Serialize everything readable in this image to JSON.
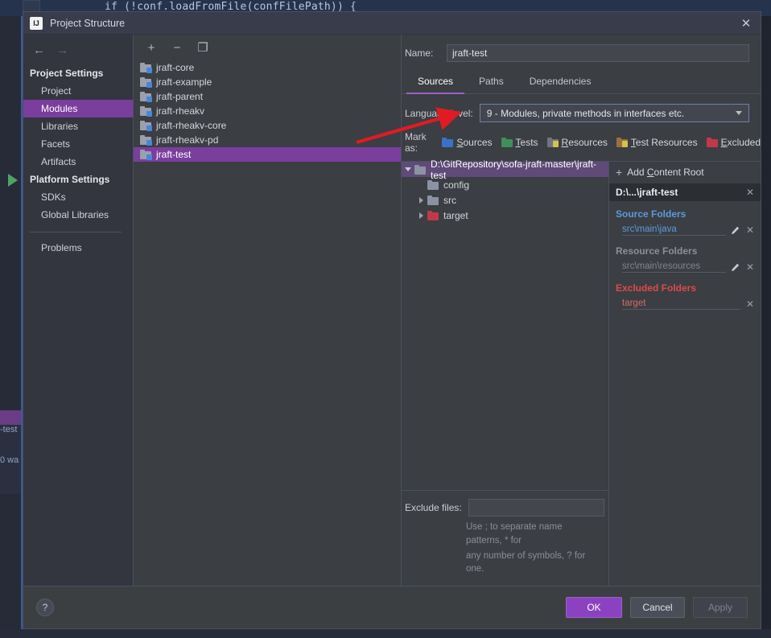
{
  "background": {
    "code_line": "if (!conf.loadFromFile(confFilePath)) {",
    "fragment_test": "-test",
    "fragment_warn": "0 wa"
  },
  "dialog": {
    "title": "Project Structure",
    "app_icon_label": "IJ",
    "close_icon": "✕"
  },
  "sidebar": {
    "nav_back_icon": "←",
    "nav_forward_icon": "→",
    "groups": [
      {
        "label": "Project Settings",
        "items": [
          {
            "label": "Project",
            "selected": false
          },
          {
            "label": "Modules",
            "selected": true
          },
          {
            "label": "Libraries",
            "selected": false
          },
          {
            "label": "Facets",
            "selected": false
          },
          {
            "label": "Artifacts",
            "selected": false
          }
        ]
      },
      {
        "label": "Platform Settings",
        "items": [
          {
            "label": "SDKs",
            "selected": false
          },
          {
            "label": "Global Libraries",
            "selected": false
          }
        ]
      }
    ],
    "problems_label": "Problems"
  },
  "modules_pane": {
    "toolbar": {
      "add_icon": "+",
      "remove_icon": "−",
      "copy_icon": "❐"
    },
    "modules": [
      {
        "name": "jraft-core",
        "selected": false
      },
      {
        "name": "jraft-example",
        "selected": false
      },
      {
        "name": "jraft-parent",
        "selected": false
      },
      {
        "name": "jraft-rheakv",
        "selected": false
      },
      {
        "name": "jraft-rheakv-core",
        "selected": false
      },
      {
        "name": "jraft-rheakv-pd",
        "selected": false
      },
      {
        "name": "jraft-test",
        "selected": true
      }
    ]
  },
  "details": {
    "name_label": "Name:",
    "name_value": "jraft-test",
    "tabs": [
      {
        "label": "Sources",
        "active": true
      },
      {
        "label": "Paths",
        "active": false
      },
      {
        "label": "Dependencies",
        "active": false
      }
    ],
    "language_level_label": "Language level:",
    "language_level_value": "9 - Modules, private methods in interfaces etc.",
    "mark_as_label": "Mark as:",
    "mark_as_options": [
      {
        "label": "Sources",
        "mnemonic": "S",
        "color": "#3c72c4",
        "overlay": ""
      },
      {
        "label": "Tests",
        "mnemonic": "T",
        "color": "#3f8f5d",
        "overlay": ""
      },
      {
        "label": "Resources",
        "mnemonic": "R",
        "color": "#6f7580",
        "overlay": "#d6c14a"
      },
      {
        "label": "Test Resources",
        "mnemonic": "T",
        "color": "#9a6f3f",
        "overlay": "#d6c14a"
      },
      {
        "label": "Excluded",
        "mnemonic": "E",
        "color": "#c0394b",
        "overlay": ""
      }
    ]
  },
  "tree": {
    "root": {
      "label": "D:\\GitRepository\\sofa-jraft-master\\jraft-test",
      "expanded": true,
      "color": "#8b93a3"
    },
    "children": [
      {
        "label": "config",
        "has_arrow": false,
        "expanded": false,
        "color": "#8b93a3"
      },
      {
        "label": "src",
        "has_arrow": true,
        "expanded": false,
        "color": "#8b93a3"
      },
      {
        "label": "target",
        "has_arrow": true,
        "expanded": false,
        "color": "#c0394b"
      }
    ]
  },
  "exclude": {
    "label": "Exclude files:",
    "value": "",
    "hint_line1": "Use ; to separate name patterns, * for",
    "hint_line2": "any number of symbols, ? for one."
  },
  "content_roots": {
    "add_label": "Add Content Root",
    "add_mnemonic": "C",
    "add_icon": "+",
    "root_label": "D:\\...\\jraft-test",
    "close_icon": "✕",
    "groups": [
      {
        "title": "Source Folders",
        "kind": "src",
        "paths": [
          {
            "path": "src\\main\\java",
            "has_edit": true,
            "has_remove": true
          }
        ]
      },
      {
        "title": "Resource Folders",
        "kind": "res",
        "paths": [
          {
            "path": "src\\main\\resources",
            "has_edit": true,
            "has_remove": true
          }
        ]
      },
      {
        "title": "Excluded Folders",
        "kind": "exc",
        "paths": [
          {
            "path": "target",
            "has_edit": false,
            "has_remove": true
          }
        ]
      }
    ]
  },
  "footer": {
    "help_label": "?",
    "ok_label": "OK",
    "cancel_label": "Cancel",
    "apply_label": "Apply"
  },
  "colors": {
    "accent_purple": "#7a3e9d",
    "ok_button": "#8b42c0",
    "source_blue": "#5c9ae0",
    "excluded_red": "#e04a4a",
    "annotation_arrow": "#e01b24"
  }
}
